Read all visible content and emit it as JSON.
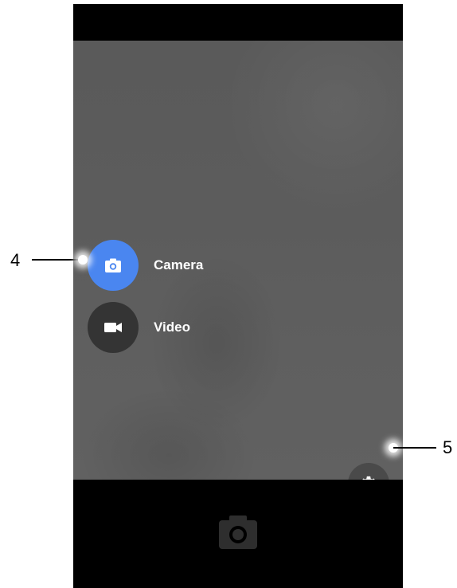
{
  "modes": {
    "camera": {
      "label": "Camera",
      "icon": "camera-icon",
      "active": true
    },
    "video": {
      "label": "Video",
      "icon": "video-icon",
      "active": false
    }
  },
  "settings": {
    "icon": "gear-icon"
  },
  "shutter": {
    "icon": "camera-shutter-icon"
  },
  "callouts": {
    "mode_menu": "4",
    "settings": "5"
  },
  "colors": {
    "active_mode": "#4a86f0",
    "inactive_mode": "#343434",
    "viewfinder": "#5c5c5c",
    "bars": "#000000"
  }
}
